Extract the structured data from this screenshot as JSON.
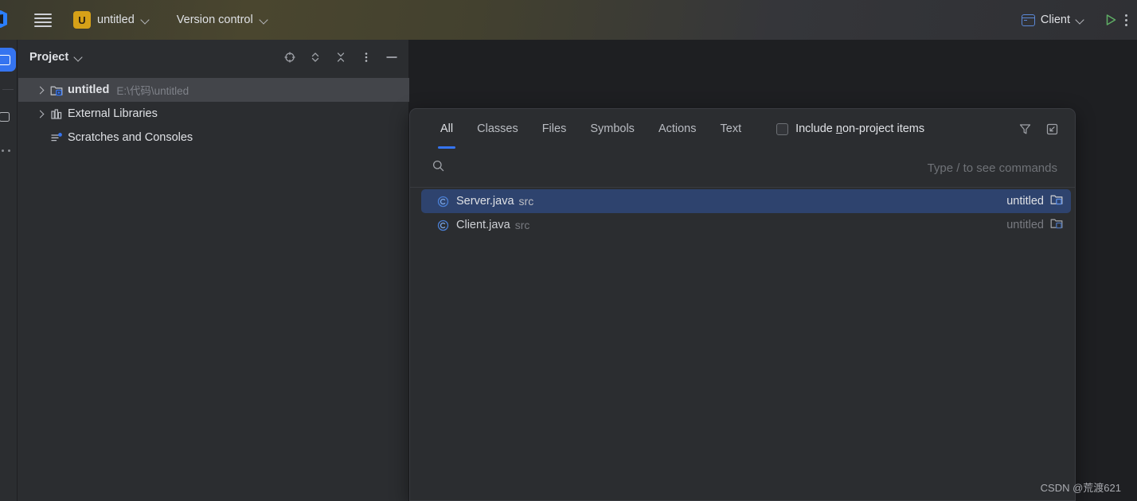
{
  "window": {
    "app": "IntelliJ IDEA",
    "watermark": "CSDN @荒渡621"
  },
  "toolbar": {
    "project_badge": "U",
    "project_name": "untitled",
    "version_control": "Version control",
    "run_config": "Client",
    "icons": {
      "menu": "hamburger-icon",
      "project_chevron": "chevron-down-icon",
      "vcs_chevron": "chevron-down-icon",
      "run": "run-play-icon",
      "more": "more-vertical-icon"
    }
  },
  "sidebar": {
    "items": [
      {
        "name": "project-tool-window",
        "icon": "project-panel-icon",
        "active": true
      },
      {
        "name": "commit-tool-window",
        "icon": "commit-panel-icon",
        "active": false
      },
      {
        "name": "more-tool-windows",
        "icon": "more-dots-icon",
        "active": false
      }
    ]
  },
  "project_panel": {
    "title": "Project",
    "title_chevron": "chevron-down-icon",
    "actions": [
      {
        "name": "select-opened-file",
        "icon": "crosshair-icon"
      },
      {
        "name": "expand-collapse",
        "icon": "expand-collapse-icon"
      },
      {
        "name": "collapse-all",
        "icon": "collapse-all-icon"
      },
      {
        "name": "options-menu",
        "icon": "more-vertical-icon"
      },
      {
        "name": "hide-panel",
        "icon": "minimize-icon"
      }
    ],
    "tree": [
      {
        "label": "untitled",
        "path": "E:\\代码\\untitled",
        "icon": "project-folder-icon",
        "arrow": "chevron-right-icon",
        "selected": true,
        "bold": true
      },
      {
        "label": "External Libraries",
        "path": "",
        "icon": "libraries-icon",
        "arrow": "chevron-right-icon",
        "selected": false,
        "bold": false
      },
      {
        "label": "Scratches and Consoles",
        "path": "",
        "icon": "scratches-icon",
        "arrow": "",
        "selected": false,
        "bold": false
      }
    ]
  },
  "search_everywhere": {
    "tabs": [
      {
        "label": "All",
        "active": true
      },
      {
        "label": "Classes",
        "active": false
      },
      {
        "label": "Files",
        "active": false
      },
      {
        "label": "Symbols",
        "active": false
      },
      {
        "label": "Actions",
        "active": false
      },
      {
        "label": "Text",
        "active": false
      }
    ],
    "include_non_project": {
      "label_before": "Include ",
      "mnemonic": "n",
      "label_after": "on-project items",
      "checked": false
    },
    "tab_actions": [
      {
        "name": "filter-button",
        "icon": "filter-funnel-icon"
      },
      {
        "name": "open-in-find-window-button",
        "icon": "open-in-find-window-icon"
      }
    ],
    "search": {
      "value": "",
      "placeholder": "",
      "hint": "Type / to see commands",
      "icon": "search-icon"
    },
    "results": [
      {
        "name": "Server.java",
        "location": "src",
        "module": "untitled",
        "icon": "java-class-icon",
        "module_icon": "module-folder-icon",
        "selected": true
      },
      {
        "name": "Client.java",
        "location": "src",
        "module": "untitled",
        "icon": "java-class-icon",
        "module_icon": "module-folder-icon",
        "selected": false
      }
    ]
  },
  "colors": {
    "accent_blue": "#3574f0",
    "selection_blue": "#2e436e",
    "badge_gold": "#d6a118",
    "run_green": "#5fad65",
    "panel_bg": "#2b2d30",
    "editor_bg": "#1e1f22"
  }
}
